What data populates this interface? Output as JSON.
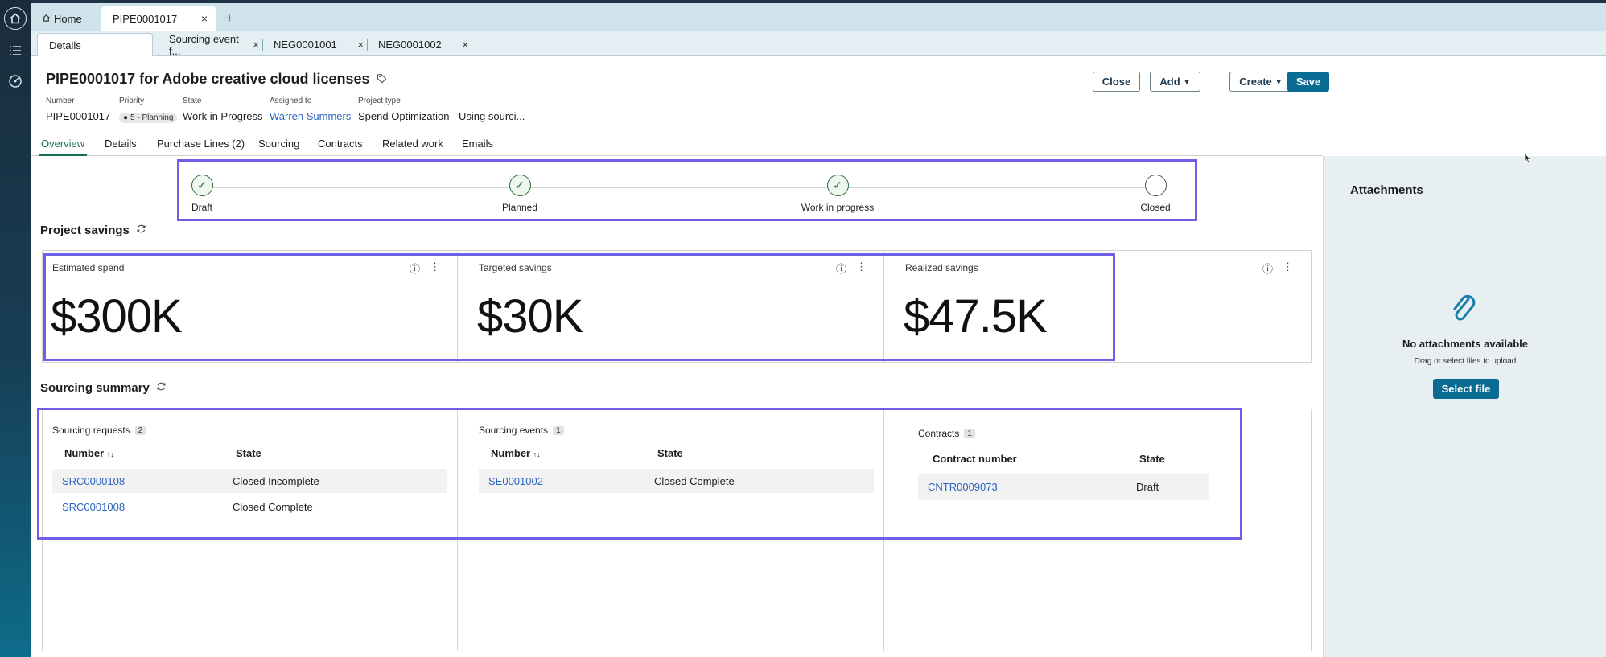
{
  "nav_rail": {
    "icons": [
      "home-icon",
      "list-icon",
      "dashboard-icon"
    ]
  },
  "top_tabs": {
    "home": "Home",
    "record": "PIPE0001017",
    "add": "+"
  },
  "sub_tabs": {
    "details": "Details",
    "sourcing_event": "Sourcing event f...",
    "neg1": "NEG0001001",
    "neg2": "NEG0001002"
  },
  "record": {
    "title": "PIPE0001017 for Adobe creative cloud licenses",
    "fields": {
      "number_label": "Number",
      "number": "PIPE0001017",
      "priority_label": "Priority",
      "priority": "5 - Planning",
      "state_label": "State",
      "state": "Work in Progress",
      "assigned_label": "Assigned to",
      "assigned": "Warren Summers",
      "project_type_label": "Project type",
      "project_type": "Spend Optimization - Using sourci..."
    }
  },
  "actions": {
    "close": "Close",
    "add": "Add",
    "create": "Create",
    "save": "Save"
  },
  "form_tabs": [
    "Overview",
    "Details",
    "Purchase Lines (2)",
    "Sourcing",
    "Contracts",
    "Related work",
    "Emails"
  ],
  "stepper": [
    "Draft",
    "Planned",
    "Work in progress",
    "Closed"
  ],
  "project_savings": {
    "title": "Project savings",
    "cards": [
      {
        "label": "Estimated spend",
        "value": "$300K"
      },
      {
        "label": "Targeted savings",
        "value": "$30K"
      },
      {
        "label": "Realized savings",
        "value": "$47.5K"
      }
    ]
  },
  "sourcing_summary": {
    "title": "Sourcing summary",
    "requests": {
      "title": "Sourcing requests",
      "count": "2",
      "col_number": "Number",
      "col_state": "State",
      "rows": [
        {
          "number": "SRC0000108",
          "state": "Closed Incomplete"
        },
        {
          "number": "SRC0001008",
          "state": "Closed Complete"
        }
      ]
    },
    "events": {
      "title": "Sourcing events",
      "count": "1",
      "col_number": "Number",
      "col_state": "State",
      "rows": [
        {
          "number": "SE0001002",
          "state": "Closed Complete"
        }
      ]
    },
    "contracts": {
      "title": "Contracts",
      "count": "1",
      "col_number": "Contract number",
      "col_state": "State",
      "rows": [
        {
          "number": "CNTR0009073",
          "state": "Draft"
        }
      ]
    }
  },
  "attachments": {
    "title": "Attachments",
    "empty": "No attachments available",
    "hint": "Drag or select files to upload",
    "button": "Select file"
  },
  "colors": {
    "accent": "#0b6c93",
    "highlight": "#6d5fe6",
    "link": "#2b64c0",
    "success": "#2d6e3a"
  }
}
